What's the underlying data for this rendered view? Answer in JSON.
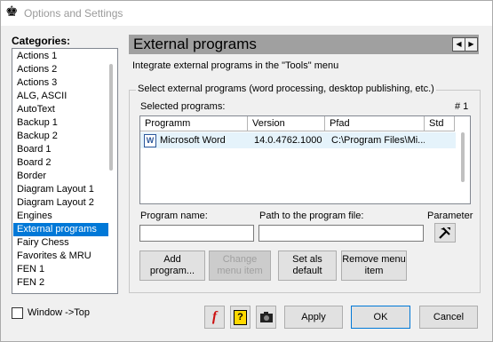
{
  "window": {
    "title": "Options and Settings"
  },
  "categories": {
    "label": "Categories:",
    "items": [
      "Actions 1",
      "Actions 2",
      "Actions 3",
      "ALG, ASCII",
      "AutoText",
      "Backup 1",
      "Backup 2",
      "Board 1",
      "Board 2",
      "Border",
      "Diagram Layout 1",
      "Diagram Layout 2",
      "Engines",
      "External programs",
      "Fairy Chess",
      "Favorites & MRU",
      "FEN 1",
      "FEN 2"
    ],
    "selected": "External programs"
  },
  "window_top": {
    "label": "Window ->Top",
    "checked": false
  },
  "panel": {
    "title": "External programs",
    "subtitle": "Integrate external programs in the \"Tools\" menu",
    "group_title": "Select external programs (word processing, desktop publishing, etc.)",
    "selected_label": "Selected programs:",
    "count": "# 1",
    "columns": [
      "Programm",
      "Version",
      "Pfad",
      "Std"
    ],
    "rows": [
      {
        "program": "Microsoft Word",
        "version": "14.0.4762.1000",
        "path": "C:\\Program Files\\Mi...",
        "std": ""
      }
    ],
    "program_name_label": "Program name:",
    "path_label": "Path to the program file:",
    "parameter_label": "Parameter",
    "program_name_value": "",
    "path_value": "",
    "buttons": {
      "add": "Add program...",
      "change": "Change menu item",
      "set_default": "Set als default",
      "remove": "Remove menu item"
    }
  },
  "footer": {
    "apply": "Apply",
    "ok": "OK",
    "cancel": "Cancel"
  },
  "colors": {
    "selection": "#0078d7",
    "header": "#a0a0a0"
  }
}
